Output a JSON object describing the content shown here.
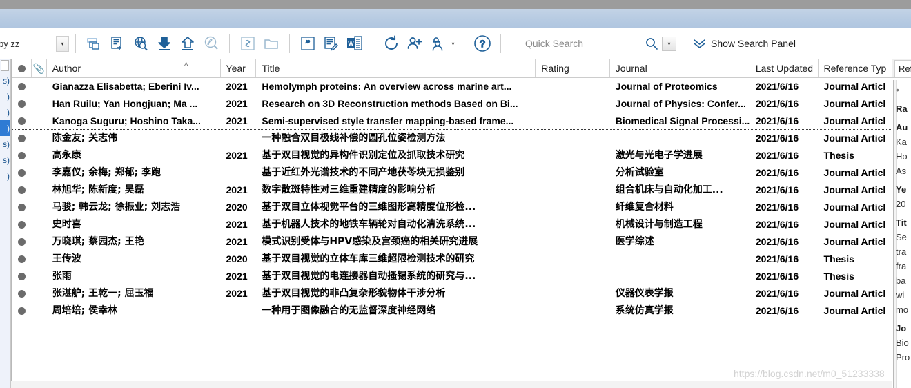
{
  "app": {
    "name": "EndNote",
    "watermark": "https://blog.csdn.net/m0_51233338"
  },
  "toolbar": {
    "style_value": "by zz",
    "style_caret": "▾",
    "buttons": [
      {
        "name": "copy-references-icon",
        "label": "Copy References To"
      },
      {
        "name": "new-reference-icon",
        "label": "New Reference"
      },
      {
        "name": "online-search-icon",
        "label": "Online Search"
      },
      {
        "name": "import-icon",
        "label": "Import"
      },
      {
        "name": "export-icon",
        "label": "Export"
      },
      {
        "name": "find-full-text-pdf-icon",
        "label": "Find Full Text"
      },
      {
        "name": "open-link-icon",
        "label": "Open Link"
      },
      {
        "name": "open-file-icon",
        "label": "Open File"
      },
      {
        "name": "insert-citation-icon",
        "label": "Insert Citation"
      },
      {
        "name": "format-bibliography-icon",
        "label": "Format Bibliography"
      },
      {
        "name": "cite-while-you-write-word-icon",
        "label": "Go To Word Processor"
      },
      {
        "name": "sync-icon",
        "label": "Sync Library"
      },
      {
        "name": "share-library-icon",
        "label": "Share Library"
      },
      {
        "name": "activity-feed-icon",
        "label": "Activity Feed"
      },
      {
        "name": "help-icon",
        "label": "Help"
      }
    ],
    "activity_caret": "▾",
    "quick_search_placeholder": "Quick Search",
    "quick_search_value": "",
    "search_caret": "▾",
    "show_search_panel": "Show Search Panel"
  },
  "left_rail": {
    "items": [
      "s)",
      ")",
      ")",
      ")",
      "s)",
      "s)",
      ")"
    ],
    "selected_index": 3
  },
  "table": {
    "columns": [
      {
        "key": "dot",
        "label": ""
      },
      {
        "key": "clip",
        "label": "📎"
      },
      {
        "key": "author",
        "label": "Author"
      },
      {
        "key": "year",
        "label": "Year"
      },
      {
        "key": "title",
        "label": "Title"
      },
      {
        "key": "rating",
        "label": "Rating"
      },
      {
        "key": "journal",
        "label": "Journal"
      },
      {
        "key": "updated",
        "label": "Last Updated"
      },
      {
        "key": "reftype",
        "label": "Reference Typ"
      }
    ],
    "sort_indicator": "˄",
    "focused_row_index": 2,
    "rows": [
      {
        "author": "Gianazza Elisabetta; Eberini Iv...",
        "year": "2021",
        "title": "Hemolymph proteins: An overview across marine art...",
        "rating": "",
        "journal": "Journal of Proteomics",
        "updated": "2021/6/16",
        "reftype": "Journal Articl"
      },
      {
        "author": "Han Ruilu; Yan Hongjuan; Ma ...",
        "year": "2021",
        "title": "Research on 3D Reconstruction methods Based on Bi...",
        "rating": "",
        "journal": "Journal of Physics: Confer...",
        "updated": "2021/6/16",
        "reftype": "Journal Articl"
      },
      {
        "author": "Kanoga Suguru; Hoshino Taka...",
        "year": "2021",
        "title": "Semi-supervised style transfer mapping-based frame...",
        "rating": "",
        "journal": "Biomedical Signal Processi...",
        "updated": "2021/6/16",
        "reftype": "Journal Articl"
      },
      {
        "author": "陈金友; 关志伟",
        "year": "",
        "title": "一种融合双目极线补偿的圆孔位姿检测方法",
        "rating": "",
        "journal": "",
        "updated": "2021/6/16",
        "reftype": "Journal Articl"
      },
      {
        "author": "高永康",
        "year": "2021",
        "title": "基于双目视觉的异构件识别定位及抓取技术研究",
        "rating": "",
        "journal": "激光与光电子学进展",
        "updated": "2021/6/16",
        "reftype": "Thesis"
      },
      {
        "author": "李嘉仪; 余梅; 郑郁; 李跑",
        "year": "",
        "title": "基于近红外光谱技术的不同产地茯苓块无损鉴别",
        "rating": "",
        "journal": "分析试验室",
        "updated": "2021/6/16",
        "reftype": "Journal Articl"
      },
      {
        "author": "林旭华; 陈新度; 吴磊",
        "year": "2021",
        "title": "数字散斑特性对三维重建精度的影响分析",
        "rating": "",
        "journal": "组合机床与自动化加工...",
        "updated": "2021/6/16",
        "reftype": "Journal Articl"
      },
      {
        "author": "马骏; 韩云龙; 徐振业; 刘志浩",
        "year": "2020",
        "title": "基于双目立体视觉平台的三维图形高精度位形检...",
        "rating": "",
        "journal": "纤维复合材料",
        "updated": "2021/6/16",
        "reftype": "Journal Articl"
      },
      {
        "author": "史时喜",
        "year": "2021",
        "title": "基于机器人技术的地铁车辆轮对自动化清洗系统...",
        "rating": "",
        "journal": "机械设计与制造工程",
        "updated": "2021/6/16",
        "reftype": "Journal Articl"
      },
      {
        "author": "万晓琪; 蔡园杰; 王艳",
        "year": "2021",
        "title": "模式识别受体与HPV感染及宫颈癌的相关研究进展",
        "rating": "",
        "journal": "医学综述",
        "updated": "2021/6/16",
        "reftype": "Journal Articl"
      },
      {
        "author": "王传波",
        "year": "2020",
        "title": "基于双目视觉的立体车库三维超限检测技术的研究",
        "rating": "",
        "journal": "",
        "updated": "2021/6/16",
        "reftype": "Thesis"
      },
      {
        "author": "张雨",
        "year": "2021",
        "title": "基于双目视觉的电连接器自动搔锡系统的研究与...",
        "rating": "",
        "journal": "",
        "updated": "2021/6/16",
        "reftype": "Thesis"
      },
      {
        "author": "张湛舮; 王乾一; 屈玉福",
        "year": "2021",
        "title": "基于双目视觉的非凸复杂形貌物体干涉分析",
        "rating": "",
        "journal": "仪器仪表学报",
        "updated": "2021/6/16",
        "reftype": "Journal Articl"
      },
      {
        "author": "周培培; 侯幸林",
        "year": "",
        "title": "一种用于图像融合的无监督深度神经网络",
        "rating": "",
        "journal": "系统仿真学报",
        "updated": "2021/6/16",
        "reftype": "Journal Articl"
      }
    ]
  },
  "preview_panel": {
    "tab_label": "Ref",
    "rating_star": "•",
    "fields": [
      {
        "label": "Ra",
        "values": []
      },
      {
        "label": "Au",
        "values": [
          "Ka",
          "Ho",
          "As"
        ]
      },
      {
        "label": "Ye",
        "values": [
          "20"
        ]
      },
      {
        "label": "Tit",
        "values": [
          "Se",
          "tra",
          "fra",
          "ba",
          "wi",
          "mo"
        ]
      },
      {
        "label": "Jo",
        "values": [
          "Bio",
          "Pro"
        ]
      }
    ]
  }
}
